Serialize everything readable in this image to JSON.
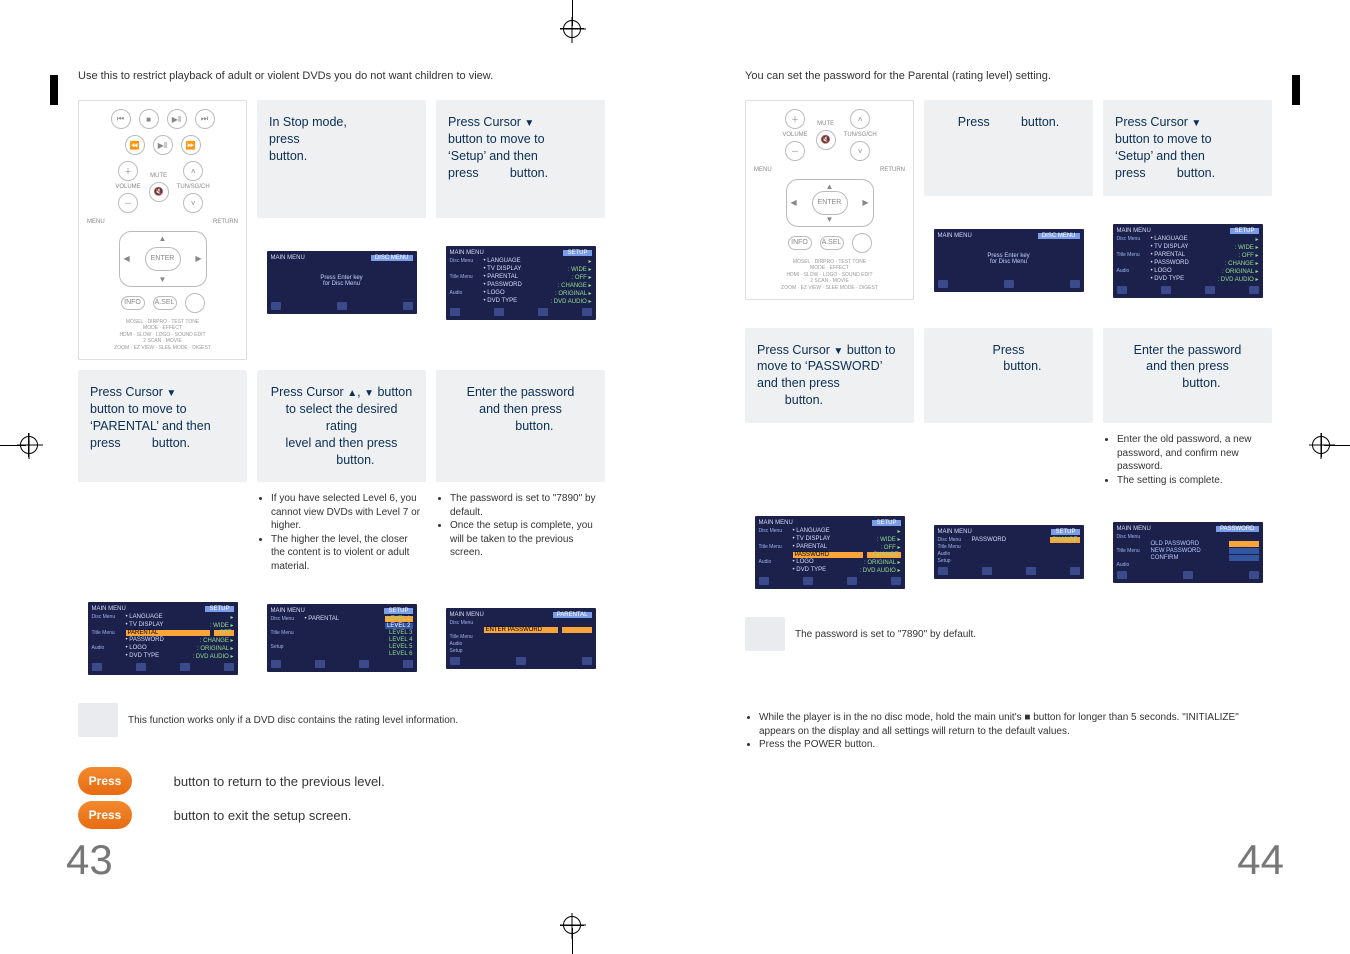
{
  "left": {
    "intro": "Use this to restrict playback of adult or violent DVDs you do not want children to view.",
    "step1": {
      "line1": "In Stop mode,",
      "line2": "press",
      "line3_tail": "button."
    },
    "step2": {
      "line1_pre": "Press Cursor",
      "line2": "button to move to",
      "line3": "‘Setup’ and then",
      "line4_pre": "press",
      "line4_tail": "button."
    },
    "step3": {
      "line1_pre": "Press Cursor",
      "line2": "button to move to",
      "line3": "‘PARENTAL’ and then",
      "line4_pre": "press",
      "line4_tail": "button."
    },
    "step4": {
      "line1_pre": "Press Cursor",
      "line1_mid": ",",
      "line1_tail": "button",
      "line2": "to select the desired rating",
      "line3": "level and then press",
      "line4_tail": "button."
    },
    "step4_notes": [
      "If you have selected Level 6, you cannot view DVDs with Level 7 or higher.",
      "The higher the level, the closer the content is to violent or adult material."
    ],
    "step5": {
      "line1": "Enter the password",
      "line2": "and then press",
      "line3_tail": "button."
    },
    "step5_notes": [
      "The password is set to \"7890\" by default.",
      "Once the setup is complete, you will be taken to the previous screen."
    ],
    "osd_setup": {
      "header_l": "MAIN MENU",
      "header_r": "SETUP",
      "side_labels": [
        "Disc Menu",
        "",
        "Title Menu",
        "",
        "Audio",
        "",
        "Setup"
      ],
      "rows": [
        {
          "k": "LANGUAGE",
          "v": ""
        },
        {
          "k": "TV DISPLAY",
          "v": "WIDE"
        },
        {
          "k": "PARENTAL",
          "v": "OFF"
        },
        {
          "k": "PASSWORD",
          "v": "CHANGE"
        },
        {
          "k": "LOGO",
          "v": "ORIGINAL"
        },
        {
          "k": "DVD TYPE",
          "v": "DVD AUDIO"
        }
      ]
    },
    "osd_disc": {
      "header_l": "MAIN MENU",
      "header_r": "DISC MENU",
      "msg1": "Press Enter key",
      "msg2": "for Disc Menu"
    },
    "osd_parental_levels": {
      "header_l": "MAIN MENU",
      "header_r": "SETUP",
      "left_col": "PARENTAL",
      "levels": [
        "LEVEL 1",
        "LEVEL 2",
        "LEVEL 3",
        "LEVEL 4",
        "LEVEL 5",
        "LEVEL 6"
      ]
    },
    "osd_parental_pw": {
      "header_l": "MAIN MENU",
      "header_r": "PARENTAL",
      "field": "ENTER PASSWORD"
    },
    "note_below": "This function works only if a DVD disc contains the rating level information.",
    "footer1_pre": "Press",
    "footer1_tail": "button to return to the previous level.",
    "footer2_pre": "Press",
    "footer2_tail": "button to exit the setup screen.",
    "page_number": "43"
  },
  "right": {
    "intro": "You can set the password for the Parental (rating level) setting.",
    "step1": {
      "pre": "Press",
      "tail": "button."
    },
    "step2": {
      "line1_pre": "Press Cursor",
      "line2": "button to move to",
      "line3": "‘Setup’ and then",
      "line4_pre": "press",
      "line4_tail": "button."
    },
    "step3": {
      "line1_pre": "Press Cursor",
      "line1_tail": "button to",
      "line2": "move to ‘PASSWORD’",
      "line3": "and then press",
      "line4_tail": "button."
    },
    "step4": {
      "line1": "Press",
      "line2_tail": "button."
    },
    "step5": {
      "line1": "Enter the password",
      "line2": "and then press",
      "line3_tail": "button."
    },
    "step5_notes": [
      "Enter the old password, a new password, and confirm new password.",
      "The setting is complete."
    ],
    "osd_pw_change": {
      "header_l": "MAIN MENU",
      "header_r": "SETUP",
      "label": "PASSWORD",
      "value": "CHANGE"
    },
    "osd_pw_fields": {
      "header_l": "MAIN MENU",
      "header_r": "PASSWORD",
      "rows": [
        "OLD PASSWORD",
        "NEW PASSWORD",
        "CONFIRM"
      ]
    },
    "note_below": "The password is set to \"7890\" by default.",
    "bottom_bullets": [
      "While the player is in the no disc mode, hold the main unit's  ■  button for longer than 5 seconds. \"INITIALIZE\" appears on the display and all settings will return to the default values.",
      "Press the POWER button."
    ],
    "page_number": "44"
  },
  "remote": {
    "mute": "MUTE",
    "volume": "VOLUME",
    "tunsgch": "TUN/SG/CH",
    "menu": "MENU",
    "return": "RETURN",
    "enter": "ENTER",
    "info": "INFO",
    "asel": "A.SEL",
    "bottom_rows": [
      [
        "",
        "MOSEL",
        "DIRPRO",
        "TEST TONE"
      ],
      [
        "MODE",
        "EFFECT",
        "",
        ""
      ],
      [
        "HDMI",
        "SLOW",
        "LOGO",
        "SOUND EDIT"
      ],
      [
        "2 SCAN",
        "MOVIE",
        "",
        ""
      ],
      [
        "ZOOM",
        "EZ VIEW",
        "SLEE MODE",
        "DIGEST"
      ]
    ]
  },
  "icons": {
    "down": "▼",
    "up": "▲",
    "stop": "■"
  }
}
